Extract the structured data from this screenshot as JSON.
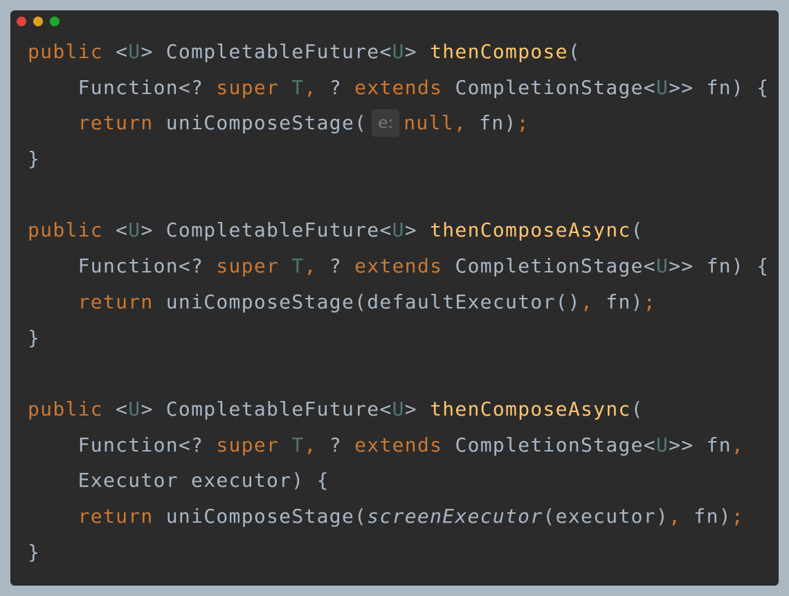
{
  "window": {
    "background": "#2b2b2b",
    "traffic_lights": [
      {
        "name": "close",
        "color": "#e0443e"
      },
      {
        "name": "minimize",
        "color": "#dea123"
      },
      {
        "name": "maximize",
        "color": "#1aab29"
      }
    ]
  },
  "colors": {
    "keyword": "#cc7832",
    "plain": "#a9b7c6",
    "type_param": "#507874",
    "method": "#ffc66d",
    "hint_text": "#787878",
    "hint_background": "#3b3b3b"
  },
  "code_lines": [
    [
      {
        "t": "public",
        "k": "kw"
      },
      {
        "t": " <",
        "k": "plain"
      },
      {
        "t": "U",
        "k": "type"
      },
      {
        "t": "> CompletableFuture<",
        "k": "plain"
      },
      {
        "t": "U",
        "k": "type"
      },
      {
        "t": "> ",
        "k": "plain"
      },
      {
        "t": "thenCompose",
        "k": "method"
      },
      {
        "t": "(",
        "k": "plain"
      }
    ],
    [
      {
        "t": "    Function<? ",
        "k": "plain"
      },
      {
        "t": "super",
        "k": "kw"
      },
      {
        "t": " ",
        "k": "plain"
      },
      {
        "t": "T",
        "k": "type"
      },
      {
        "t": ",",
        "k": "kw"
      },
      {
        "t": " ? ",
        "k": "plain"
      },
      {
        "t": "extends",
        "k": "kw"
      },
      {
        "t": " CompletionStage<",
        "k": "plain"
      },
      {
        "t": "U",
        "k": "type"
      },
      {
        "t": ">> fn) {",
        "k": "plain"
      }
    ],
    [
      {
        "t": "    ",
        "k": "plain"
      },
      {
        "t": "return",
        "k": "kw"
      },
      {
        "t": " uniComposeStage(",
        "k": "plain"
      },
      {
        "t": "e:",
        "k": "hint"
      },
      {
        "t": "null",
        "k": "kw"
      },
      {
        "t": ",",
        "k": "kw"
      },
      {
        "t": " fn)",
        "k": "plain"
      },
      {
        "t": ";",
        "k": "kw"
      }
    ],
    [
      {
        "t": "}",
        "k": "plain"
      }
    ],
    [],
    [
      {
        "t": "public",
        "k": "kw"
      },
      {
        "t": " <",
        "k": "plain"
      },
      {
        "t": "U",
        "k": "type"
      },
      {
        "t": "> CompletableFuture<",
        "k": "plain"
      },
      {
        "t": "U",
        "k": "type"
      },
      {
        "t": "> ",
        "k": "plain"
      },
      {
        "t": "thenComposeAsync",
        "k": "method"
      },
      {
        "t": "(",
        "k": "plain"
      }
    ],
    [
      {
        "t": "    Function<? ",
        "k": "plain"
      },
      {
        "t": "super",
        "k": "kw"
      },
      {
        "t": " ",
        "k": "plain"
      },
      {
        "t": "T",
        "k": "type"
      },
      {
        "t": ",",
        "k": "kw"
      },
      {
        "t": " ? ",
        "k": "plain"
      },
      {
        "t": "extends",
        "k": "kw"
      },
      {
        "t": " CompletionStage<",
        "k": "plain"
      },
      {
        "t": "U",
        "k": "type"
      },
      {
        "t": ">> fn) {",
        "k": "plain"
      }
    ],
    [
      {
        "t": "    ",
        "k": "plain"
      },
      {
        "t": "return",
        "k": "kw"
      },
      {
        "t": " uniComposeStage(defaultExecutor()",
        "k": "plain"
      },
      {
        "t": ",",
        "k": "kw"
      },
      {
        "t": " fn)",
        "k": "plain"
      },
      {
        "t": ";",
        "k": "kw"
      }
    ],
    [
      {
        "t": "}",
        "k": "plain"
      }
    ],
    [],
    [
      {
        "t": "public",
        "k": "kw"
      },
      {
        "t": " <",
        "k": "plain"
      },
      {
        "t": "U",
        "k": "type"
      },
      {
        "t": "> CompletableFuture<",
        "k": "plain"
      },
      {
        "t": "U",
        "k": "type"
      },
      {
        "t": "> ",
        "k": "plain"
      },
      {
        "t": "thenComposeAsync",
        "k": "method"
      },
      {
        "t": "(",
        "k": "plain"
      }
    ],
    [
      {
        "t": "    Function<? ",
        "k": "plain"
      },
      {
        "t": "super",
        "k": "kw"
      },
      {
        "t": " ",
        "k": "plain"
      },
      {
        "t": "T",
        "k": "type"
      },
      {
        "t": ",",
        "k": "kw"
      },
      {
        "t": " ? ",
        "k": "plain"
      },
      {
        "t": "extends",
        "k": "kw"
      },
      {
        "t": " CompletionStage<",
        "k": "plain"
      },
      {
        "t": "U",
        "k": "type"
      },
      {
        "t": ">> fn",
        "k": "plain"
      },
      {
        "t": ",",
        "k": "kw"
      }
    ],
    [
      {
        "t": "    Executor executor) {",
        "k": "plain"
      }
    ],
    [
      {
        "t": "    ",
        "k": "plain"
      },
      {
        "t": "return",
        "k": "kw"
      },
      {
        "t": " uniComposeStage(",
        "k": "plain"
      },
      {
        "t": "screenExecutor",
        "k": "italic"
      },
      {
        "t": "(executor)",
        "k": "plain"
      },
      {
        "t": ",",
        "k": "kw"
      },
      {
        "t": " fn)",
        "k": "plain"
      },
      {
        "t": ";",
        "k": "kw"
      }
    ],
    [
      {
        "t": "}",
        "k": "plain"
      }
    ]
  ]
}
